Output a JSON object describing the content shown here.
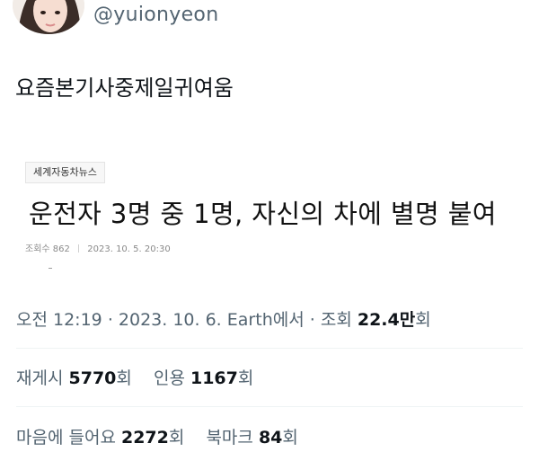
{
  "author": {
    "handle": "@yuionyeon"
  },
  "tweet": {
    "text": "요즘본기사중제일귀여움"
  },
  "article": {
    "source": "세계자동차뉴스",
    "headline": "운전자 3명 중 1명, 자신의 차에 별명 붙여",
    "views_label": "조회수",
    "views": "862",
    "date": "2023. 10. 5. 20:30"
  },
  "meta": {
    "time": "오전 12:19",
    "date": "2023. 10. 6.",
    "place": "Earth에서",
    "views_prefix": "조회",
    "views_value": "22.4만",
    "views_suffix": "회"
  },
  "stats": {
    "retweets_label": "재게시",
    "retweets_value": "5770",
    "retweets_suffix": "회",
    "quotes_label": "인용",
    "quotes_value": "1167",
    "quotes_suffix": "회",
    "likes_label": "마음에 들어요",
    "likes_value": "2272",
    "likes_suffix": "회",
    "bookmarks_label": "북마크",
    "bookmarks_value": "84",
    "bookmarks_suffix": "회"
  }
}
